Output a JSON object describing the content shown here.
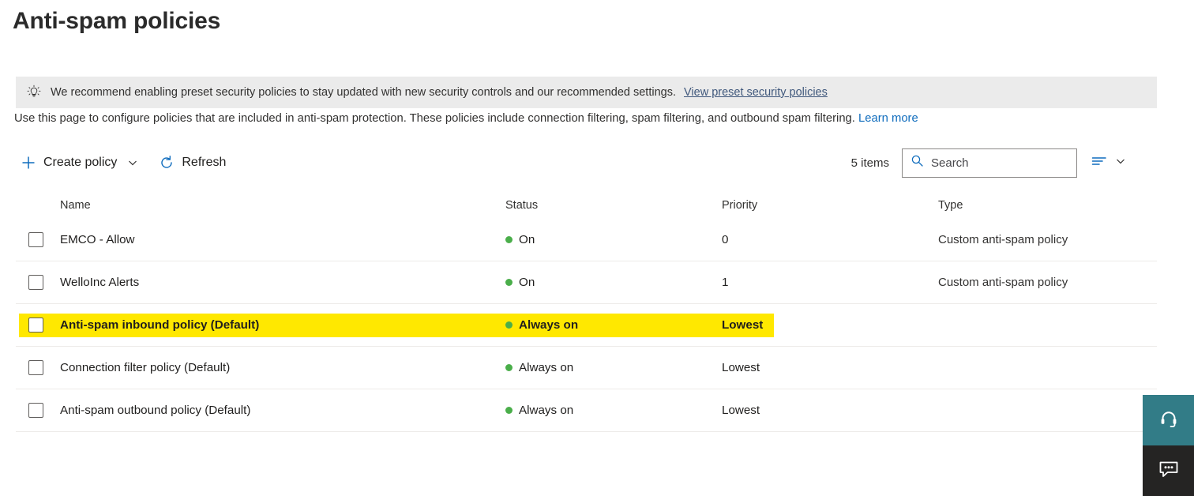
{
  "page": {
    "title": "Anti-spam policies"
  },
  "banner": {
    "icon": "lightbulb-icon",
    "text": "We recommend enabling preset security policies to stay updated with new security controls and our recommended settings.",
    "link_label": "View preset security policies"
  },
  "description": {
    "text": "Use this page to configure policies that are included in anti-spam protection. These policies include connection filtering, spam filtering, and outbound spam filtering.",
    "link_label": "Learn more"
  },
  "toolbar": {
    "create_policy_label": "Create policy",
    "create_policy_icon": "plus-icon",
    "create_policy_chevron": "chevron-down-icon",
    "refresh_label": "Refresh",
    "refresh_icon": "refresh-icon",
    "items_count": "5 items",
    "search_placeholder": "Search",
    "search_value": "",
    "search_icon": "search-icon",
    "list_options_icon": "list-options-icon",
    "list_options_chevron": "chevron-down-icon"
  },
  "table": {
    "columns": [
      "Name",
      "Status",
      "Priority",
      "Type"
    ],
    "rows": [
      {
        "name": "EMCO - Allow",
        "status": "On",
        "priority": "0",
        "type": "Custom anti-spam policy",
        "selected": false,
        "highlighted": false
      },
      {
        "name": "WelloInc Alerts",
        "status": "On",
        "priority": "1",
        "type": "Custom anti-spam policy",
        "selected": false,
        "highlighted": false
      },
      {
        "name": "Anti-spam inbound policy (Default)",
        "status": "Always on",
        "priority": "Lowest",
        "type": "",
        "selected": false,
        "highlighted": true
      },
      {
        "name": "Connection filter policy (Default)",
        "status": "Always on",
        "priority": "Lowest",
        "type": "",
        "selected": false,
        "highlighted": false
      },
      {
        "name": "Anti-spam outbound policy (Default)",
        "status": "Always on",
        "priority": "Lowest",
        "type": "",
        "selected": false,
        "highlighted": false
      }
    ]
  },
  "floating": {
    "support_icon": "headset-icon",
    "feedback_icon": "feedback-chat-icon"
  },
  "colors": {
    "accent_blue": "#0f6cbd",
    "banner_bg": "#ebebeb",
    "status_green": "#4aae4a",
    "highlight_yellow": "#ffe800",
    "support_teal": "#327c87",
    "feedback_dark": "#252423"
  }
}
